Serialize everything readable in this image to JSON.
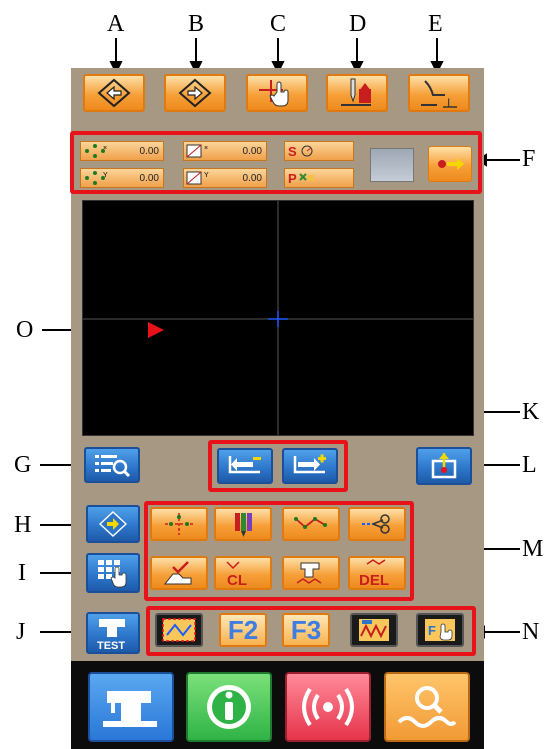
{
  "callouts": {
    "A": "A",
    "B": "B",
    "C": "C",
    "D": "D",
    "E": "E",
    "F": "F",
    "G": "G",
    "H": "H",
    "I": "I",
    "J": "J",
    "K": "K",
    "L": "L",
    "M": "M",
    "N": "N",
    "O": "O"
  },
  "status_panel": {
    "x_offset": "0.00",
    "y_offset": "0.00",
    "x_size": "0.00",
    "y_size": "0.00",
    "speed_label": "S",
    "pattern_label": "P"
  },
  "f_keys": {
    "f2": "F2",
    "f3": "F3"
  },
  "icon_labels": {
    "cl": "CL",
    "del": "DEL",
    "test": "TEST"
  },
  "colors": {
    "panel_bg": "#a69882",
    "orange_btn": "#f6a03a",
    "blue_btn": "#2c74c8",
    "highlight": "#e8121a",
    "screen_bg": "#000000",
    "crosshair": "#1f5cff"
  },
  "bottom_nav": [
    {
      "icon": "sewing-machine-icon",
      "color": "#2a77d8"
    },
    {
      "icon": "info-icon",
      "color": "#2fb346"
    },
    {
      "icon": "signal-icon",
      "color": "#e6344a"
    },
    {
      "icon": "search-icon",
      "color": "#f19a35"
    }
  ]
}
